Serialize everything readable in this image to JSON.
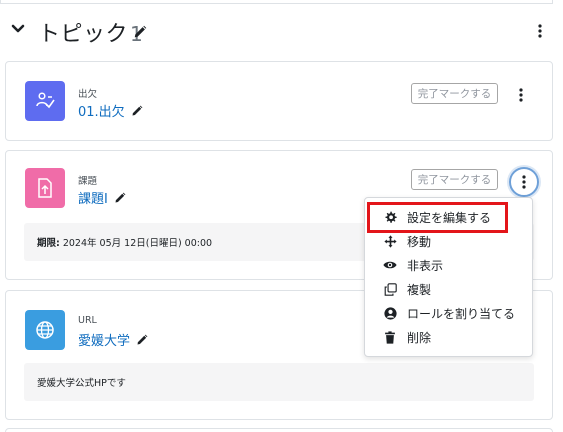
{
  "section": {
    "title": "トピック",
    "number": "1"
  },
  "activities": [
    {
      "type_label": "出欠",
      "name": "01.出欠",
      "icon": "attendance-icon",
      "icon_color": "#5e6cf0",
      "completion_button": "完了マークする"
    },
    {
      "type_label": "課題",
      "name": "課題Ⅰ",
      "icon": "assignment-icon",
      "icon_color": "#f06ca8",
      "completion_button": "完了マークする",
      "due_label": "期限:",
      "due_value": "2024年 05月 12日(日曜日) 00:00"
    },
    {
      "type_label": "URL",
      "name": "愛媛大学",
      "icon": "globe-icon",
      "icon_color": "#3a9de0",
      "description": "愛媛大学公式HPです"
    }
  ],
  "action_menu": {
    "items": [
      {
        "label": "設定を編集する",
        "icon": "gear-icon"
      },
      {
        "label": "移動",
        "icon": "move-icon"
      },
      {
        "label": "非表示",
        "icon": "eye-icon"
      },
      {
        "label": "複製",
        "icon": "copy-icon"
      },
      {
        "label": "ロールを割り当てる",
        "icon": "user-circle-icon"
      },
      {
        "label": "削除",
        "icon": "trash-icon"
      }
    ],
    "highlight_color": "#e3151a"
  },
  "colors": {
    "link": "#0f6cbf",
    "focus_ring": "#6ea0d8"
  }
}
